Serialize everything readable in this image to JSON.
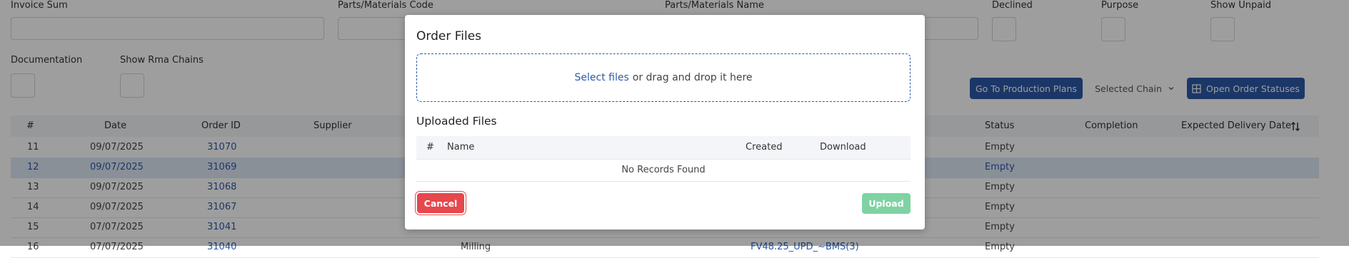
{
  "filters": {
    "invoice_sum": "Invoice Sum",
    "parts_code": "Parts/Materials Code",
    "parts_name": "Parts/Materials Name",
    "declined": "Declined",
    "purpose": "Purpose",
    "show_unpaid": "Show Unpaid",
    "documentation": "Documentation",
    "show_rma_chains": "Show Rma Chains"
  },
  "toolbar": {
    "go_to_production_plans": "Go To Production Plans",
    "selected_chain": "Selected Chain",
    "open_order_statuses": "Open Order Statuses"
  },
  "table": {
    "columns": [
      "#",
      "Date",
      "Order ID",
      "Supplier",
      "Status",
      "Completion",
      "Expected Delivery Date"
    ],
    "rows": [
      {
        "num": "11",
        "date": "09/07/2025",
        "order_id": "31070",
        "status": "Empty"
      },
      {
        "num": "12",
        "date": "09/07/2025",
        "order_id": "31069",
        "status": "Empty",
        "selected": true
      },
      {
        "num": "13",
        "date": "09/07/2025",
        "order_id": "31068",
        "status": "Empty"
      },
      {
        "num": "14",
        "date": "09/07/2025",
        "order_id": "31067",
        "status": "Empty"
      },
      {
        "num": "15",
        "date": "07/07/2025",
        "order_id": "31041",
        "status": "Empty"
      },
      {
        "num": "16",
        "date": "07/07/2025",
        "order_id": "31040",
        "status": "Empty",
        "extra1": "Milling",
        "extra2": "FV48.25_UPD_~BMS(3)"
      }
    ]
  },
  "modal": {
    "title": "Order Files",
    "select_files": "Select files",
    "drop_text": "or drag and drop it here",
    "uploaded_title": "Uploaded Files",
    "columns": [
      "#",
      "Name",
      "Created",
      "Download"
    ],
    "empty": "No Records Found",
    "cancel": "Cancel",
    "upload": "Upload"
  }
}
